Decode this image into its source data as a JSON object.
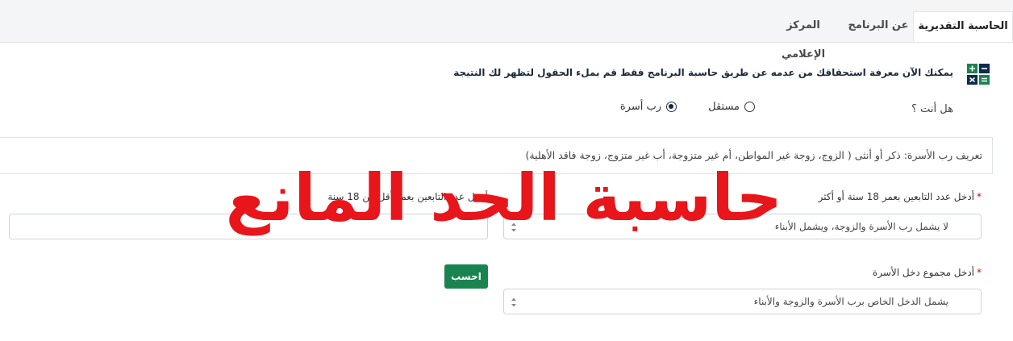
{
  "tabs": [
    {
      "label": "الحاسبة التقديرية",
      "active": true
    },
    {
      "label": "عن البرنامج",
      "active": false
    },
    {
      "label": "المركز الإعلامي",
      "active": false
    }
  ],
  "intro_text": "يمكنك الآن معرفة استحقاقك من عدمه عن طريق حاسبة البرنامج فقط قم بملء الحقول لتظهر لك النتيجة",
  "question": "هل أنت ؟",
  "options": [
    {
      "label": "رب أسرة",
      "checked": true
    },
    {
      "label": "مستقل",
      "checked": false
    }
  ],
  "definition": "تعريف رب الأسرة: ذكر أو أنثى ( الزوج، زوجة غير المواطن، أم غير متزوجة، أب غير متزوج، زوجة فاقد الأهلية)",
  "fields": {
    "dependents_18_plus": {
      "label": "أدخل عدد التابعين بعمر 18 سنة أو أكثر",
      "placeholder": "لا يشمل رب الأسرة والزوجة، ويشمل الأبناء"
    },
    "dependents_under_18": {
      "label": "أدخل عدد التابعين بعمر أقل من 18 سنة",
      "placeholder": ""
    },
    "income": {
      "label": "أدخل مجموع دخل الأسرة",
      "placeholder": "يشمل الدخل الخاص برب الأسرة والزوجة والأبناء"
    }
  },
  "required_mark": "*",
  "submit_label": "احسب",
  "watermark": "حاسبة الحد المانع",
  "colors": {
    "accent": "#1a8450",
    "watermark": "#e8151b",
    "navy": "#0d2b4a"
  }
}
